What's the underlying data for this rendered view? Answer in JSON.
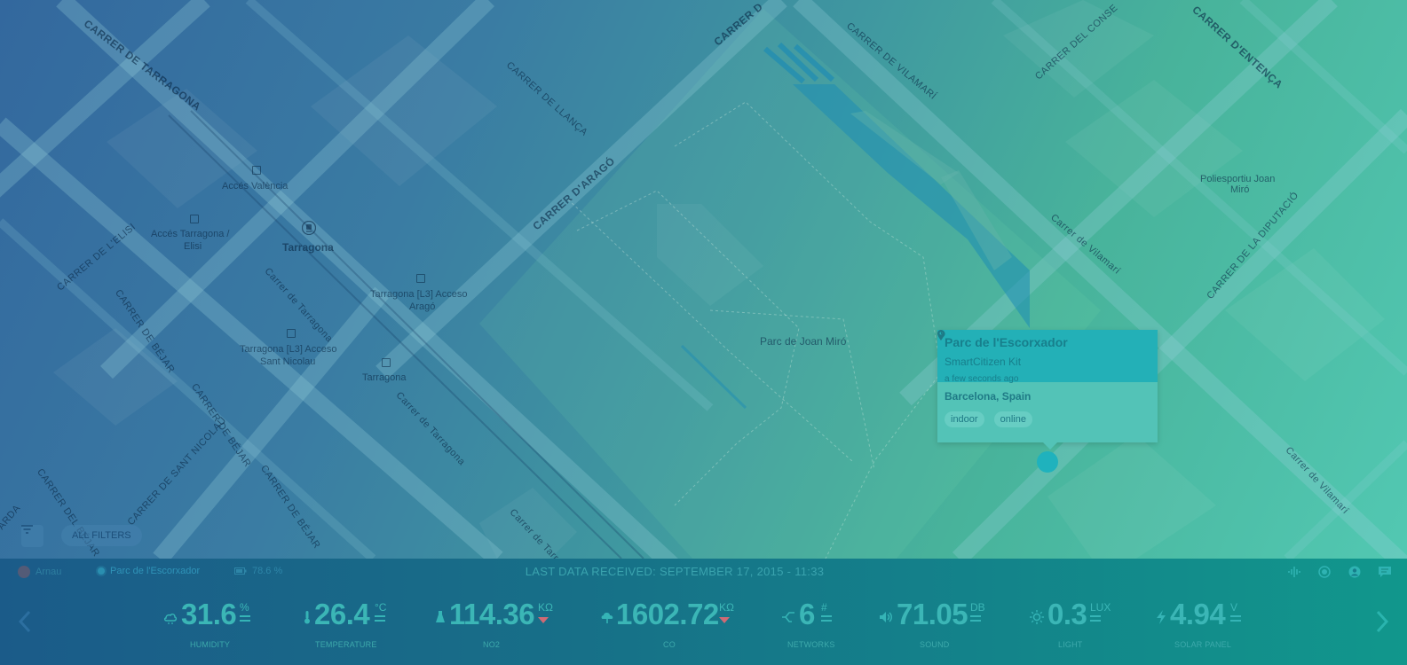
{
  "map": {
    "streets": [
      "CARRER DE TARRAGONA",
      "CARRER DE LLANÇA",
      "CARRER D'ARAGÓ",
      "CARRER DE VILAMARÍ",
      "CARRER DEL CONSE",
      "CARRER D'ENTENÇA",
      "CARRER DE L'ELISI",
      "CARRER DE BÉJAR",
      "Carrer de Tarragona",
      "Carrer de Vilamarí",
      "CARRER DE LA DIPUTACIÓ",
      "CARRER DE BÉJAR",
      "CARRER DE SANT NICOLAU",
      "CARRER DEL BÉJAR",
      "Carrer de Tarragona",
      "Carrer de Tarr",
      "Carrer de Vilamarí",
      "CARRER DE BÉJAR",
      "ARDA",
      "CARRER D"
    ],
    "pois": {
      "acces_valencia": "Accés València",
      "acces_tarragona_elisi_1": "Accés Tarragona /",
      "acces_tarragona_elisi_2": "Elisi",
      "tarragona_station": "Tarragona",
      "acces_arago_1": "Tarragona [L3] Acceso",
      "acces_arago_2": "Aragó",
      "acces_sant_nicolau_1": "Tarragona [L3] Acceso",
      "acces_sant_nicolau_2": "Sant Nicolau",
      "tarragona_small": "Tarragona",
      "poliesportiu_1": "Poliesportiu Joan",
      "poliesportiu_2": "Miró",
      "park": "Parc de Joan Miró"
    }
  },
  "popup": {
    "title": "Parc de l'Escorxador",
    "kit": "SmartCitizen Kit",
    "time": "a few seconds ago",
    "location": "Barcelona, Spain",
    "tags": [
      "indoor",
      "online"
    ]
  },
  "filters": {
    "chip_label": "ALL FILTERS"
  },
  "status": {
    "user": "Arnau",
    "device": "Parc de l'Escorxador",
    "battery": "78.6 %",
    "last_data": "LAST DATA RECEIVED: SEPTEMBER 17, 2015 - 11:33"
  },
  "metrics": [
    {
      "name": "HUMIDITY",
      "value": "31.6",
      "unit": "%",
      "trend": "equal",
      "icon": "humidity-icon"
    },
    {
      "name": "TEMPERATURE",
      "value": "26.4",
      "unit": "°C",
      "trend": "equal",
      "icon": "thermometer-icon"
    },
    {
      "name": "NO2",
      "value": "114.36",
      "unit": "KΩ",
      "trend": "down",
      "icon": "no2-icon"
    },
    {
      "name": "CO",
      "value": "1602.72",
      "unit": "KΩ",
      "trend": "down",
      "icon": "co-icon"
    },
    {
      "name": "NETWORKS",
      "value": "6",
      "unit": "#",
      "trend": "equal",
      "icon": "networks-icon"
    },
    {
      "name": "SOUND",
      "value": "71.05",
      "unit": "DB",
      "trend": "equal",
      "icon": "speaker-icon"
    },
    {
      "name": "LIGHT",
      "value": "0.3",
      "unit": "LUX",
      "trend": "equal",
      "icon": "sun-icon"
    },
    {
      "name": "SOLAR PANEL",
      "value": "4.94",
      "unit": "V",
      "trend": "equal",
      "icon": "bolt-icon"
    }
  ],
  "colors": {
    "panel_text": "#3bb6b6",
    "trend_down": "#cf6a74",
    "popup_head": "#23b0b7",
    "popup_body": "#53c3b7"
  }
}
